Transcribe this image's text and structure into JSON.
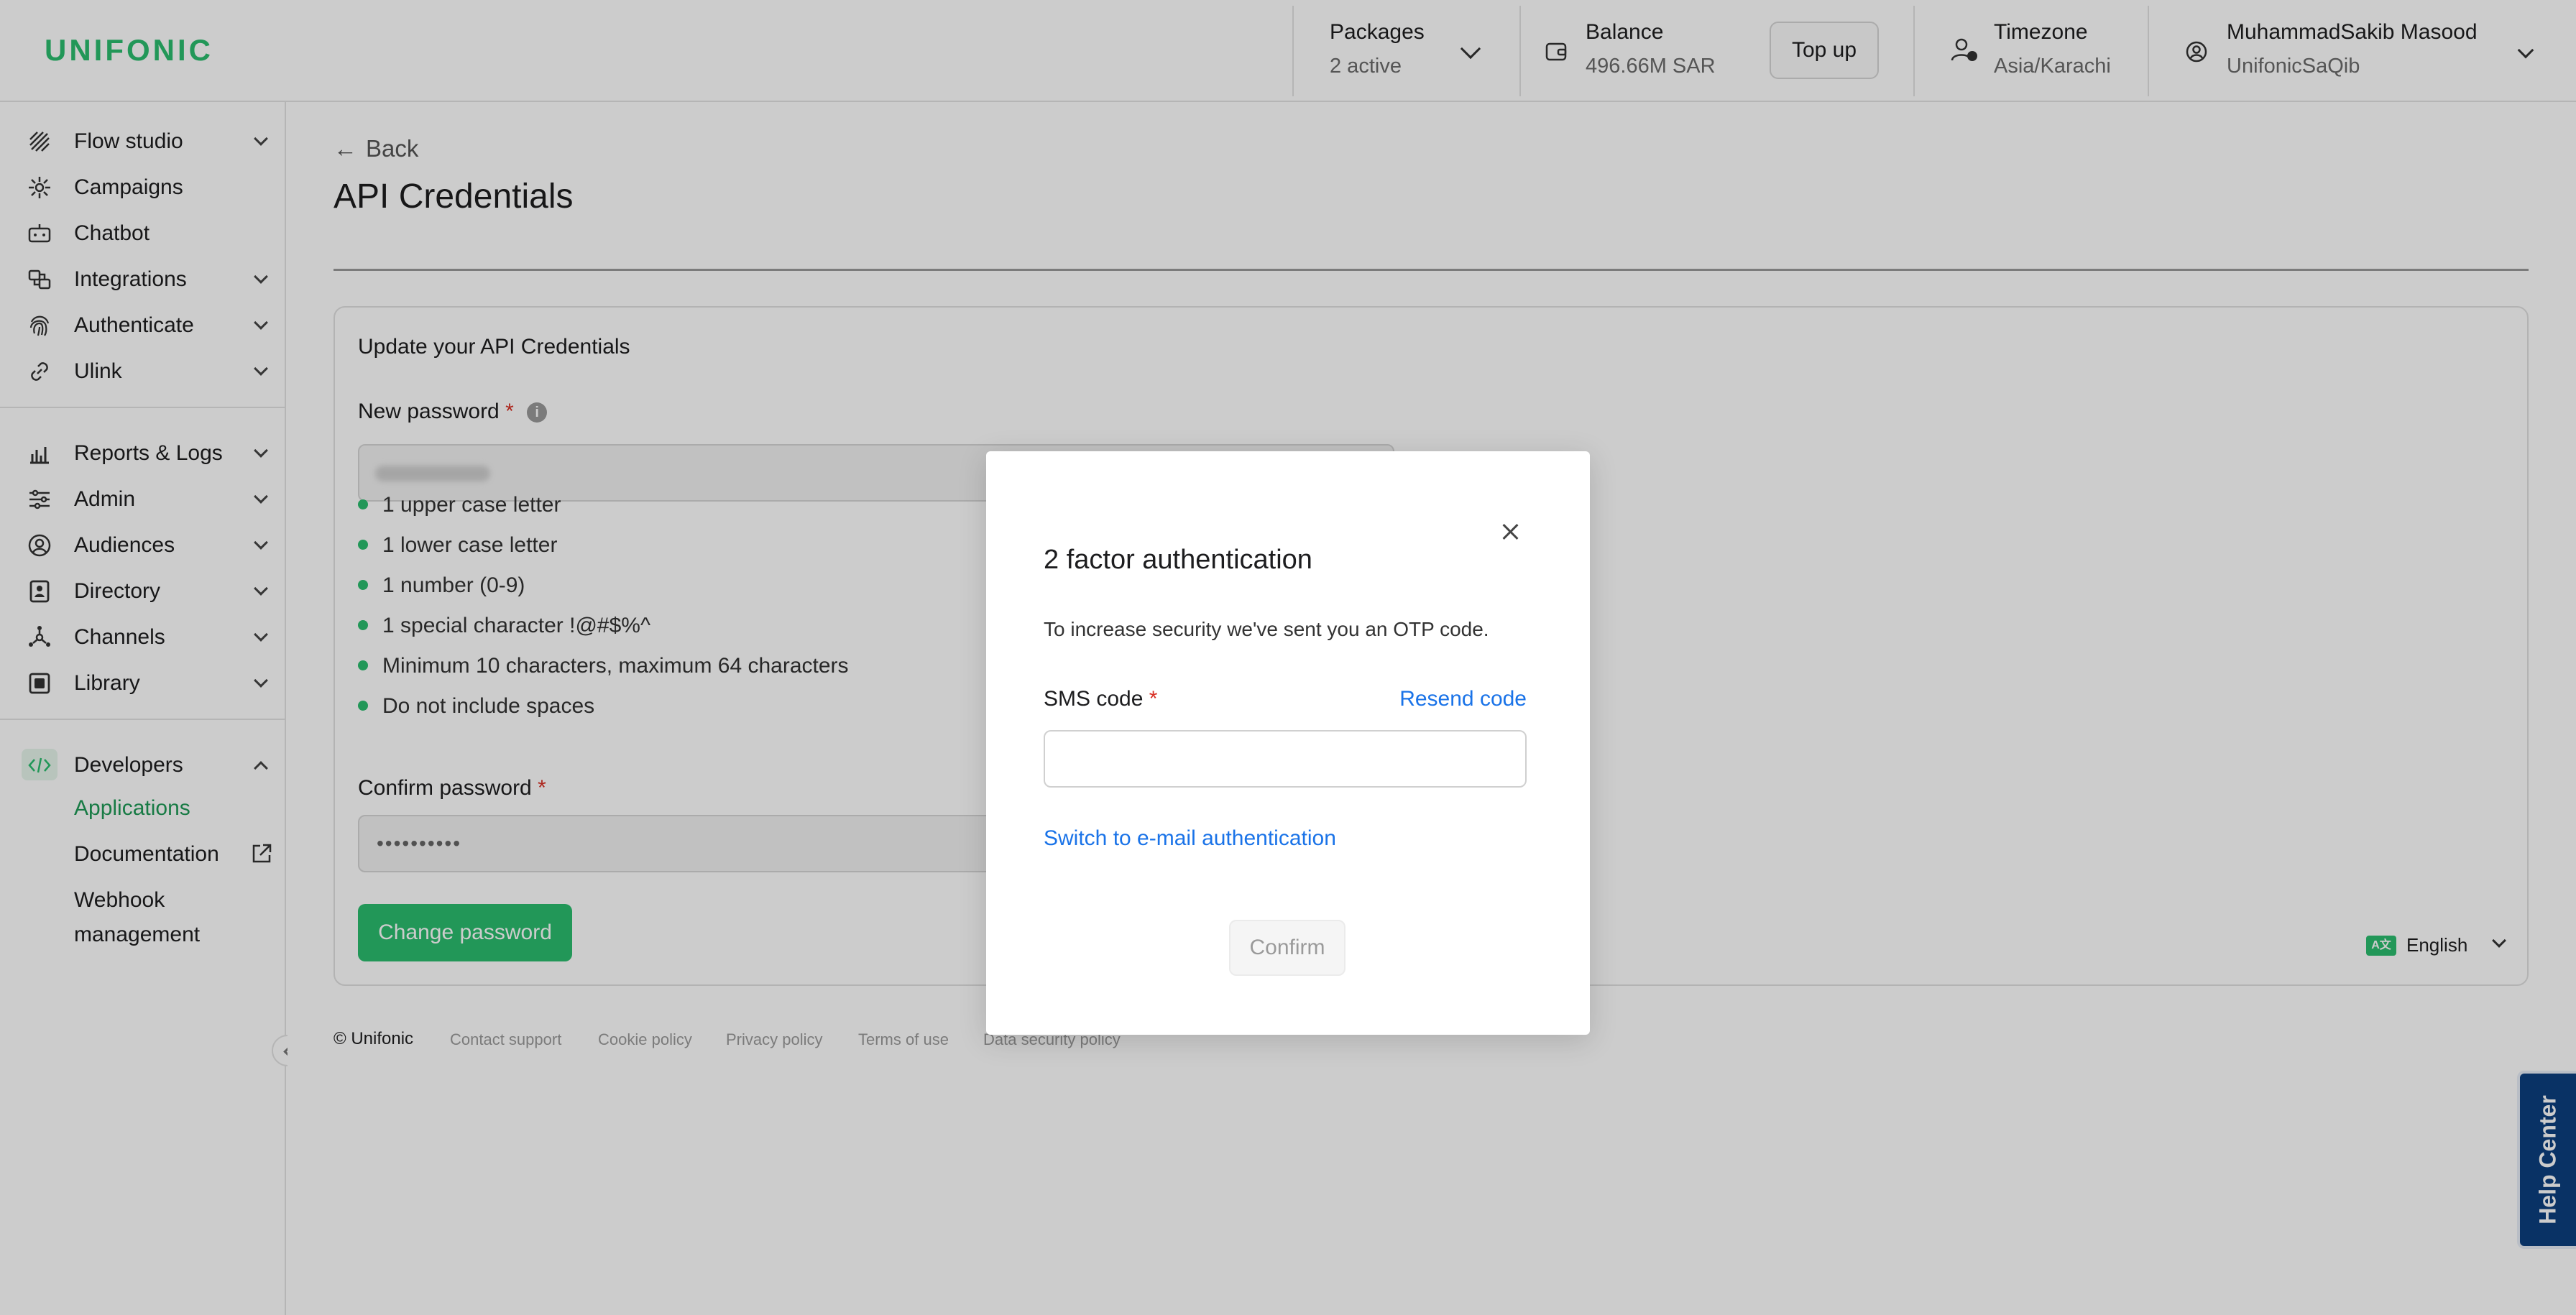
{
  "header": {
    "logo": "UNIFONIC",
    "packages": {
      "title": "Packages",
      "value": "2 active"
    },
    "balance": {
      "title": "Balance",
      "value": "496.66M SAR",
      "topup_label": "Top up"
    },
    "timezone": {
      "title": "Timezone",
      "value": "Asia/Karachi"
    },
    "user": {
      "name": "MuhammadSakib Masood",
      "account": "UnifonicSaQib"
    }
  },
  "sidebar": {
    "items": [
      {
        "label": "Flow studio",
        "icon": "flow-studio-icon"
      },
      {
        "label": "Campaigns",
        "icon": "campaigns-icon"
      },
      {
        "label": "Chatbot",
        "icon": "chatbot-icon"
      },
      {
        "label": "Integrations",
        "icon": "integrations-icon"
      },
      {
        "label": "Authenticate",
        "icon": "fingerprint-icon"
      },
      {
        "label": "Ulink",
        "icon": "link-icon"
      },
      {
        "label": "Reports & Logs",
        "icon": "chart-icon"
      },
      {
        "label": "Admin",
        "icon": "sliders-icon"
      },
      {
        "label": "Audiences",
        "icon": "audience-icon"
      },
      {
        "label": "Directory",
        "icon": "directory-icon"
      },
      {
        "label": "Channels",
        "icon": "channels-icon"
      },
      {
        "label": "Library",
        "icon": "library-icon"
      },
      {
        "label": "Developers",
        "icon": "code-icon"
      }
    ],
    "developers_sub": {
      "applications": "Applications",
      "documentation": "Documentation",
      "webhook_line1": "Webhook",
      "webhook_line2": "management"
    }
  },
  "main": {
    "back_label": "Back",
    "title": "API Credentials",
    "card_title": "Update your API Credentials",
    "new_password_label": "New password",
    "required_mark": "*",
    "password_rules": [
      "1 upper case letter",
      "1 lower case letter",
      "1 number (0-9)",
      "1 special character !@#$%^",
      "Minimum 10 characters, maximum 64 characters",
      "Do not include spaces"
    ],
    "confirm_password_label": "Confirm password",
    "confirm_password_masked": "••••••••••",
    "change_password_button": "Change password"
  },
  "footer": {
    "copyright": "© Unifonic",
    "links": [
      "Contact support",
      "Cookie policy",
      "Privacy policy",
      "Terms of use",
      "Data security policy"
    ],
    "language": "English",
    "help_center": "Help Center"
  },
  "modal": {
    "title": "2 factor authentication",
    "description": "To increase security we've sent you an OTP code.",
    "sms_label": "SMS code",
    "resend_label": "Resend code",
    "sms_value": "",
    "switch_label": "Switch to e-mail authentication",
    "confirm_label": "Confirm"
  },
  "colors": {
    "brand_green": "#2bbd6e",
    "link_blue": "#1a73e8",
    "help_navy": "#0c3f7f",
    "required_red": "#d93025"
  }
}
